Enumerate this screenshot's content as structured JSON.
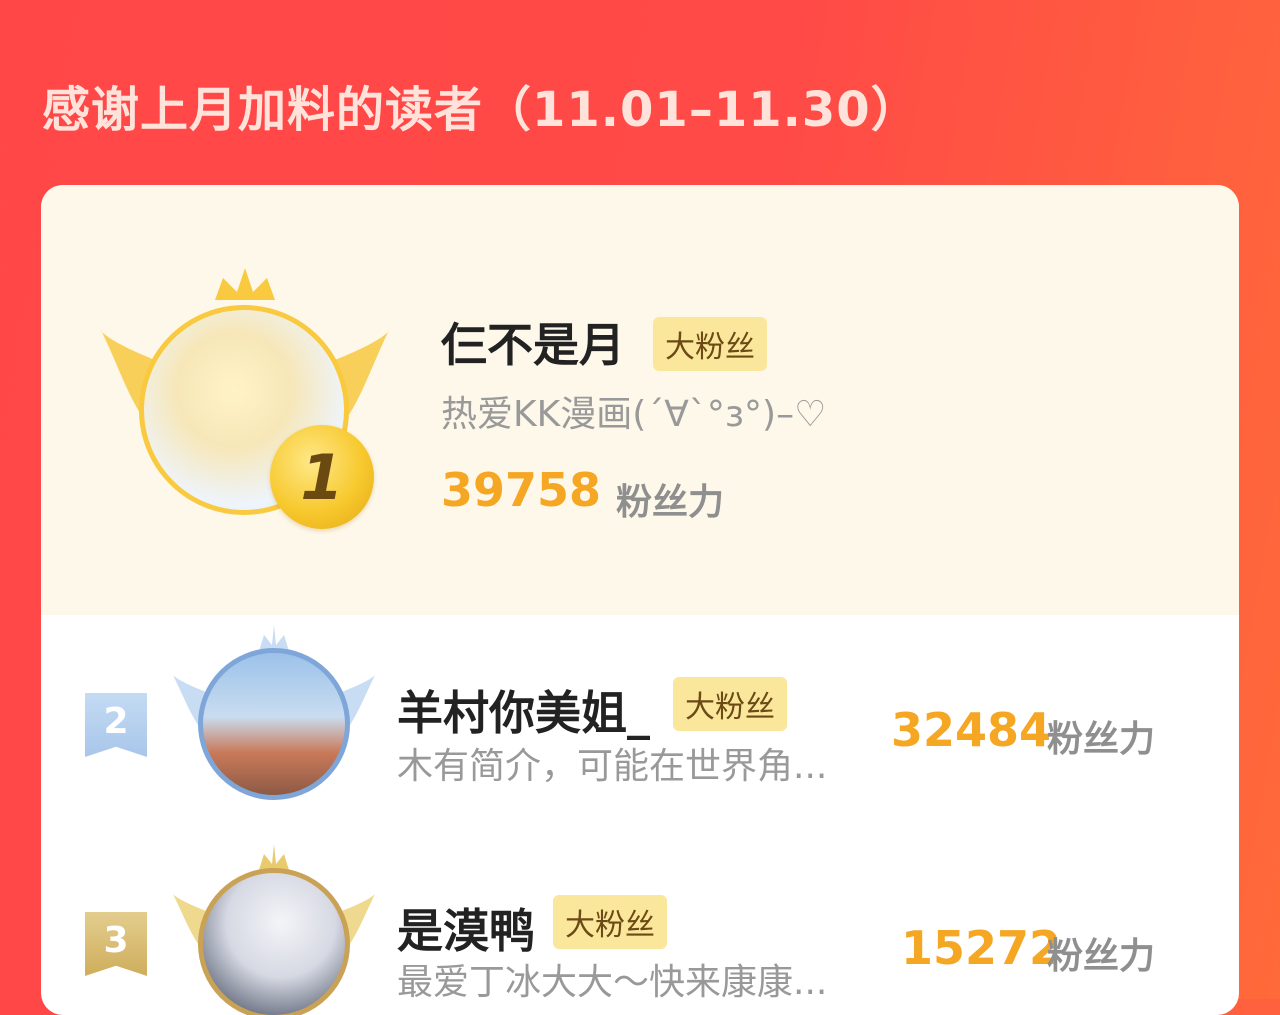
{
  "header": {
    "title": "感谢上月加料的读者（11.01–11.30）"
  },
  "colors": {
    "background": "#ff4747",
    "gold": "#f5a623",
    "badge_bg": "#fbe79b"
  },
  "top_reader": {
    "rank": "1",
    "name": "仨不是月",
    "badge": "大粉丝",
    "intro": "热爱KK漫画(ˊ∀ˋ°з°)–♡",
    "score": "39758",
    "score_unit": "粉丝力"
  },
  "readers": [
    {
      "rank": "2",
      "name": "羊村你美姐_",
      "badge": "大粉丝",
      "intro": "木有简介，可能在世界角...",
      "score": "32484",
      "score_unit": "粉丝力"
    },
    {
      "rank": "3",
      "name": "是漠鸭",
      "badge": "大粉丝",
      "intro": "最爱丁冰大大～快来康康...",
      "score": "15272",
      "score_unit": "粉丝力"
    }
  ]
}
